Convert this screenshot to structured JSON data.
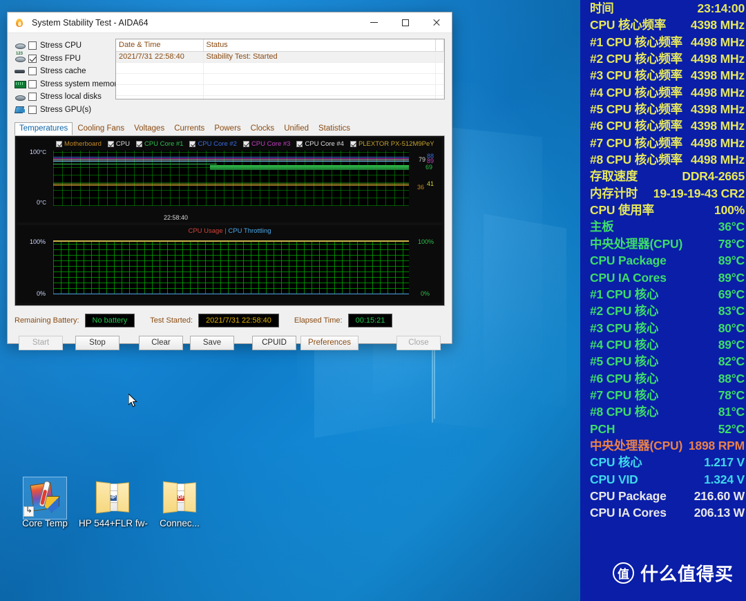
{
  "window": {
    "title": "System Stability Test - AIDA64",
    "icon": "flame-icon",
    "minimize": "–",
    "maximize": "□",
    "close": "✕"
  },
  "stress_options": [
    {
      "label": "Stress CPU",
      "checked": false,
      "icon": "cpu-icon"
    },
    {
      "label": "Stress FPU",
      "checked": true,
      "icon": "fpu-icon"
    },
    {
      "label": "Stress cache",
      "checked": false,
      "icon": "cache-icon"
    },
    {
      "label": "Stress system memory",
      "checked": false,
      "icon": "memory-icon"
    },
    {
      "label": "Stress local disks",
      "checked": false,
      "icon": "disk-icon"
    },
    {
      "label": "Stress GPU(s)",
      "checked": false,
      "icon": "gpu-icon"
    }
  ],
  "log": {
    "columns": [
      "Date & Time",
      "Status"
    ],
    "rows": [
      {
        "datetime": "2021/7/31 22:58:40",
        "status": "Stability Test: Started"
      }
    ]
  },
  "tabs": [
    {
      "label": "Temperatures",
      "active": true
    },
    {
      "label": "Cooling Fans",
      "active": false
    },
    {
      "label": "Voltages",
      "active": false
    },
    {
      "label": "Currents",
      "active": false
    },
    {
      "label": "Powers",
      "active": false
    },
    {
      "label": "Clocks",
      "active": false
    },
    {
      "label": "Unified",
      "active": false
    },
    {
      "label": "Statistics",
      "active": false
    }
  ],
  "legend": [
    {
      "label": "Motherboard",
      "color": "#c48a28",
      "checked": true
    },
    {
      "label": "CPU",
      "color": "#d8d8d8",
      "checked": true
    },
    {
      "label": "CPU Core #1",
      "color": "#2fbf4a",
      "checked": true
    },
    {
      "label": "CPU Core #2",
      "color": "#3b6cdb",
      "checked": true
    },
    {
      "label": "CPU Core #3",
      "color": "#c13fc1",
      "checked": true
    },
    {
      "label": "CPU Core #4",
      "color": "#d8d8d8",
      "checked": true
    },
    {
      "label": "PLEXTOR PX-512M9PeY",
      "color": "#c4a12a",
      "checked": true
    }
  ],
  "chart_data": [
    {
      "type": "line",
      "name": "temperatures",
      "title": "",
      "ylabel": "°C",
      "ylim": [
        0,
        100
      ],
      "y_top_label": "100",
      "y_top_unit": "°C",
      "y_bottom_label": "0",
      "y_bottom_unit": "°C",
      "x_tick_label": "22:58:40",
      "grid": true,
      "right_value_labels": [
        "79",
        "88",
        "89",
        "69",
        "36",
        "41"
      ],
      "series": [
        {
          "name": "CPU Core #2",
          "color": "#3b6cdb",
          "last_value": 88,
          "level_pct": 0.88
        },
        {
          "name": "CPU Core #3",
          "color": "#c13fc1",
          "last_value": 89,
          "level_pct": 0.87
        },
        {
          "name": "CPU",
          "color": "#d8d8d8",
          "last_value": 79,
          "level_pct": 0.84
        },
        {
          "name": "CPU Core #1",
          "color": "#2fbf4a",
          "last_value": 69,
          "level_pct": 0.78
        },
        {
          "name": "Motherboard",
          "color": "#c48a28",
          "last_value": 36,
          "level_pct": 0.38
        },
        {
          "name": "PLEXTOR PX-512M9PeY",
          "color": "#d6d43a",
          "last_value": 41,
          "level_pct": 0.42
        }
      ]
    },
    {
      "type": "line",
      "name": "cpu_usage",
      "title_parts": [
        "CPU Usage",
        "|",
        "CPU Throttling"
      ],
      "ylabel": "%",
      "ylim": [
        0,
        100
      ],
      "y_top_label_left": "100%",
      "y_bottom_label_left": "0%",
      "y_top_label_right": "100%",
      "y_bottom_label_right": "0%",
      "grid": true,
      "series": [
        {
          "name": "CPU Usage",
          "color": "#c9b64a",
          "last_value": 100
        },
        {
          "name": "CPU Throttling",
          "color": "#4aa8e8",
          "last_value": 0
        }
      ]
    }
  ],
  "status": {
    "battery_label": "Remaining Battery:",
    "battery_value": "No battery",
    "started_label": "Test Started:",
    "started_value": "2021/7/31 22:58:40",
    "elapsed_label": "Elapsed Time:",
    "elapsed_value": "00:15:21"
  },
  "buttons": [
    {
      "label": "Start",
      "disabled": true
    },
    {
      "label": "Stop",
      "disabled": false
    },
    {
      "label": "Clear",
      "disabled": false
    },
    {
      "label": "Save",
      "disabled": false
    },
    {
      "label": "CPUID",
      "disabled": false
    },
    {
      "label": "Preferences",
      "disabled": false
    },
    {
      "label": "Close",
      "disabled": true
    }
  ],
  "osd": {
    "rows": [
      {
        "key": "时间",
        "value": "23:14:00",
        "color": "#e6e85c"
      },
      {
        "key": "CPU 核心频率",
        "value": "4398 MHz",
        "color": "#e6e85c"
      },
      {
        "key": "#1 CPU 核心频率",
        "value": "4498 MHz",
        "color": "#e6e85c"
      },
      {
        "key": "#2 CPU 核心频率",
        "value": "4498 MHz",
        "color": "#e6e85c"
      },
      {
        "key": "#3 CPU 核心频率",
        "value": "4398 MHz",
        "color": "#e6e85c"
      },
      {
        "key": "#4 CPU 核心频率",
        "value": "4498 MHz",
        "color": "#e6e85c"
      },
      {
        "key": "#5 CPU 核心频率",
        "value": "4398 MHz",
        "color": "#e6e85c"
      },
      {
        "key": "#6 CPU 核心频率",
        "value": "4398 MHz",
        "color": "#e6e85c"
      },
      {
        "key": "#7 CPU 核心频率",
        "value": "4498 MHz",
        "color": "#e6e85c"
      },
      {
        "key": "#8 CPU 核心频率",
        "value": "4498 MHz",
        "color": "#e6e85c"
      },
      {
        "key": "存取速度",
        "value": "DDR4-2665",
        "color": "#e6e85c"
      },
      {
        "key": "内存计时",
        "value": "19-19-19-43 CR2",
        "color": "#e6e85c"
      },
      {
        "key": "CPU 使用率",
        "value": "100%",
        "color": "#e6e85c"
      },
      {
        "key": "主板",
        "value": "36°C",
        "color": "#3ddc6a"
      },
      {
        "key": "中央处理器(CPU)",
        "value": "78°C",
        "color": "#3ddc6a"
      },
      {
        "key": "CPU Package",
        "value": "89°C",
        "color": "#3ddc6a"
      },
      {
        "key": "CPU IA Cores",
        "value": "89°C",
        "color": "#3ddc6a"
      },
      {
        "key": "#1 CPU 核心",
        "value": "69°C",
        "color": "#3ddc6a"
      },
      {
        "key": "#2 CPU 核心",
        "value": "83°C",
        "color": "#3ddc6a"
      },
      {
        "key": "#3 CPU 核心",
        "value": "80°C",
        "color": "#3ddc6a"
      },
      {
        "key": "#4 CPU 核心",
        "value": "89°C",
        "color": "#3ddc6a"
      },
      {
        "key": "#5 CPU 核心",
        "value": "82°C",
        "color": "#3ddc6a"
      },
      {
        "key": "#6 CPU 核心",
        "value": "88°C",
        "color": "#3ddc6a"
      },
      {
        "key": "#7 CPU 核心",
        "value": "78°C",
        "color": "#3ddc6a"
      },
      {
        "key": "#8 CPU 核心",
        "value": "81°C",
        "color": "#3ddc6a"
      },
      {
        "key": "PCH",
        "value": "52°C",
        "color": "#3ddc6a"
      },
      {
        "key": "中央处理器(CPU)",
        "value": "1898 RPM",
        "color": "#e8814a"
      },
      {
        "key": "CPU 核心",
        "value": "1.217 V",
        "color": "#3fd8ea"
      },
      {
        "key": "CPU VID",
        "value": "1.324 V",
        "color": "#3fd8ea"
      },
      {
        "key": "CPU Package",
        "value": "216.60 W",
        "color": "#e8e8e8"
      },
      {
        "key": "CPU IA Cores",
        "value": "206.13 W",
        "color": "#e8e8e8"
      }
    ]
  },
  "desktop": {
    "icons": [
      {
        "label": "Core Temp",
        "icon": "core-temp-app-icon",
        "selected": true
      },
      {
        "label": "HP 544+FLR fw-",
        "icon": "folder-icon",
        "selected": false
      },
      {
        "label": "Connec...",
        "icon": "folder-pdf-icon",
        "selected": false
      }
    ],
    "partial_label": "h",
    "label_hp": "HP 544+FLR fw-Connec..."
  },
  "watermark": {
    "badge": "值",
    "text": "什么值得买"
  }
}
